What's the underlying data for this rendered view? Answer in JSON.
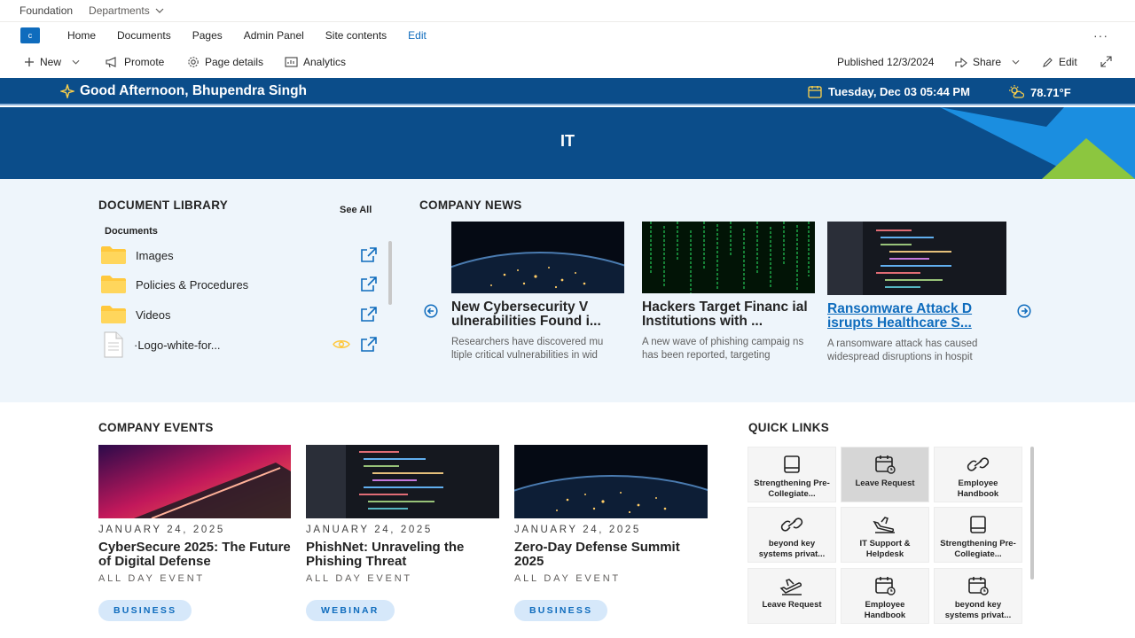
{
  "suite": {
    "site_name": "Foundation",
    "dept_label": "Departments"
  },
  "nav": {
    "logo_letter": "c",
    "items": [
      "Home",
      "Documents",
      "Pages",
      "Admin Panel",
      "Site contents"
    ],
    "edit_label": "Edit",
    "more_label": "···"
  },
  "command_bar": {
    "new_label": "New",
    "promote_label": "Promote",
    "page_details_label": "Page details",
    "analytics_label": "Analytics",
    "published_label": "Published 12/3/2024",
    "share_label": "Share",
    "edit_label": "Edit"
  },
  "greeting": {
    "text": "Good Afternoon, Bhupendra Singh",
    "datetime": "Tuesday, Dec 03 05:44 PM",
    "temperature": "78.71°F"
  },
  "banner": {
    "title": "IT"
  },
  "document_library": {
    "heading": "DOCUMENT LIBRARY",
    "see_all": "See All",
    "subheading": "Documents",
    "items": [
      {
        "name": "Images",
        "type": "folder"
      },
      {
        "name": "Policies & Procedures",
        "type": "folder"
      },
      {
        "name": "Videos",
        "type": "folder"
      },
      {
        "name": "·Logo-white-for...",
        "type": "file"
      }
    ]
  },
  "company_news": {
    "heading": "COMPANY NEWS",
    "articles": [
      {
        "title": "New Cybersecurity V ulnerabilities Found i...",
        "desc": "Researchers have discovered mu ltiple critical vulnerabilities in wid"
      },
      {
        "title": "Hackers Target Financ ial Institutions with ...",
        "desc": "A new wave of phishing campaig ns has been reported, targeting"
      },
      {
        "title": "Ransomware Attack D isrupts Healthcare S...",
        "desc": "A ransomware attack has caused widespread disruptions in hospit"
      }
    ]
  },
  "company_events": {
    "heading": "COMPANY EVENTS",
    "events": [
      {
        "date": "JANUARY 24, 2025",
        "title": "CyberSecure 2025: The Future of Digital Defense",
        "time": "ALL DAY EVENT",
        "tag": "BUSINESS"
      },
      {
        "date": "JANUARY 24, 2025",
        "title": "PhishNet: Unraveling the Phishing Threat",
        "time": "ALL DAY EVENT",
        "tag": "WEBINAR"
      },
      {
        "date": "JANUARY 24, 2025",
        "title": "Zero-Day Defense Summit 2025",
        "time": "ALL DAY EVENT",
        "tag": "BUSINESS"
      }
    ]
  },
  "quick_links": {
    "heading": "QUICK LINKS",
    "items": [
      {
        "label": "Strengthening Pre-Collegiate...",
        "icon": "tablet-icon"
      },
      {
        "label": "Leave Request",
        "icon": "calendar-icon"
      },
      {
        "label": "Employee Handbook",
        "icon": "link-icon"
      },
      {
        "label": "beyond key systems privat...",
        "icon": "link-icon"
      },
      {
        "label": "IT Support & Helpdesk",
        "icon": "plane-landing-icon"
      },
      {
        "label": "Strengthening Pre-Collegiate...",
        "icon": "tablet-icon"
      },
      {
        "label": "Leave Request",
        "icon": "plane-takeoff-icon"
      },
      {
        "label": "Employee Handbook",
        "icon": "calendar-icon"
      },
      {
        "label": "beyond key systems privat...",
        "icon": "calendar-icon"
      }
    ]
  },
  "colors": {
    "brand_blue": "#0b4d8a",
    "accent_blue": "#0f6cbd",
    "banner_green": "#8cc63f",
    "banner_light_blue": "#1b8ee0",
    "tag_bg": "#d6e8fa",
    "folder_yellow": "#ffc83d"
  }
}
